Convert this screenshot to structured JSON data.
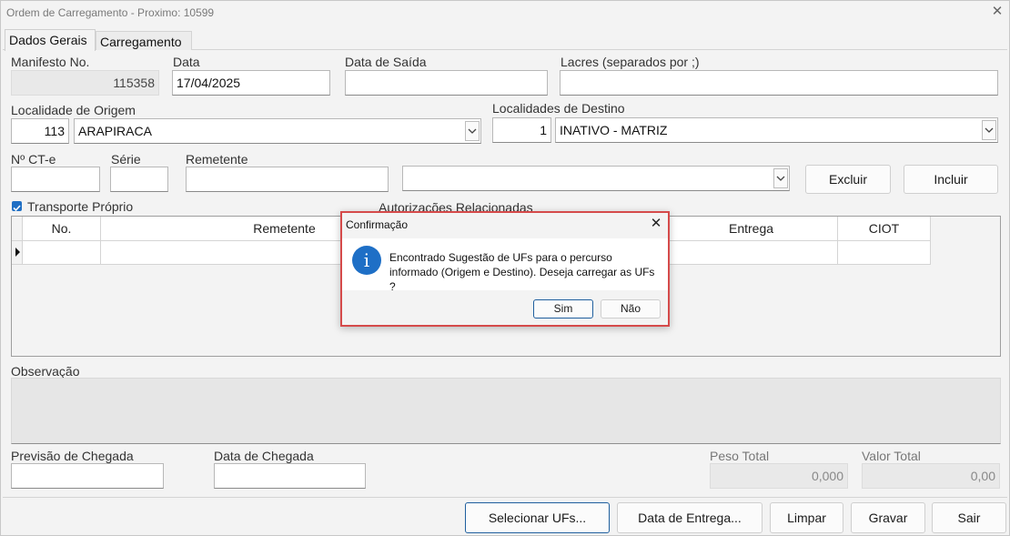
{
  "window": {
    "title": "Ordem de Carregamento - Proximo: 10599"
  },
  "tabs": [
    {
      "label": "Dados Gerais"
    },
    {
      "label": "Carregamento"
    }
  ],
  "form": {
    "manifesto": {
      "label": "Manifesto No.",
      "value": "115358"
    },
    "data": {
      "label": "Data",
      "value": "17/04/2025"
    },
    "data_saida": {
      "label": "Data de Saída",
      "value": ""
    },
    "lacres": {
      "label": "Lacres (separados por ;)",
      "value": ""
    },
    "origem": {
      "label": "Localidade de Origem",
      "code": "113",
      "name": "ARAPIRACA"
    },
    "destino": {
      "label": "Localidades de Destino",
      "code": "1",
      "name": "INATIVO - MATRIZ"
    },
    "ct_e": {
      "label": "Nº CT-e",
      "value": ""
    },
    "serie": {
      "label": "Série",
      "value": ""
    },
    "remetente": {
      "label": "Remetente",
      "value": ""
    },
    "transporte_proprio": {
      "label": "Transporte Próprio",
      "checked": true
    },
    "autorizacoes_label": "Autorizações Relacionadas",
    "observacao_label": "Observação",
    "previsao_chegada": {
      "label": "Previsão de Chegada",
      "value": ""
    },
    "data_chegada": {
      "label": "Data de Chegada",
      "value": ""
    },
    "peso_total": {
      "label": "Peso Total",
      "value": "0,000"
    },
    "valor_total": {
      "label": "Valor Total",
      "value": "0,00"
    }
  },
  "buttons": {
    "excluir": "Excluir",
    "incluir": "Incluir",
    "selecionar_ufs": "Selecionar UFs...",
    "data_entrega": "Data de Entrega...",
    "limpar": "Limpar",
    "gravar": "Gravar",
    "sair": "Sair"
  },
  "grid": {
    "columns": [
      "No.",
      "Remetente",
      "Entrega",
      "CIOT"
    ]
  },
  "dialog": {
    "title": "Confirmação",
    "message": "Encontrado Sugestão de UFs para o percurso informado (Origem e Destino). Deseja carregar as UFs ?",
    "yes": "Sim",
    "no": "Não"
  },
  "colors": {
    "accent": "#1e6fc6",
    "dialog_border": "#d54a4a"
  }
}
